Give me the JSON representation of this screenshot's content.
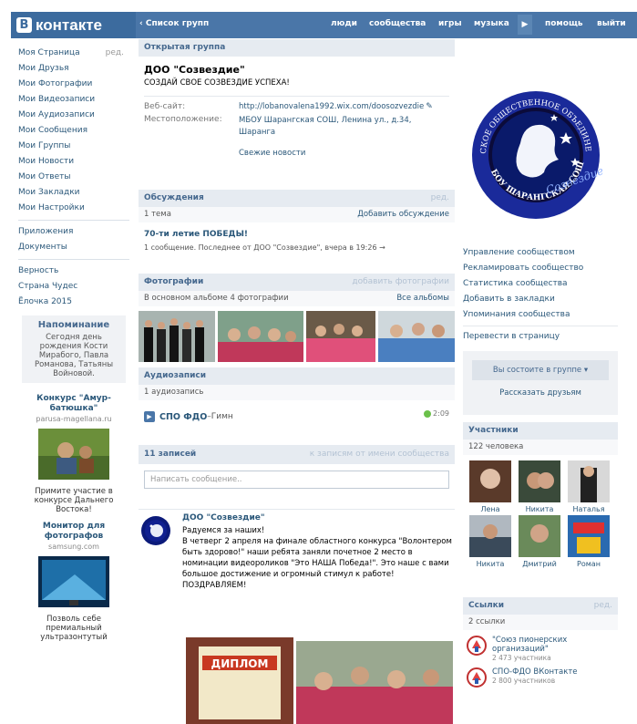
{
  "header": {
    "logo": "контакте",
    "logo_letter": "В",
    "back": "‹ Список групп",
    "nav": [
      "люди",
      "сообщества",
      "игры",
      "музыка",
      "▶",
      "помощь",
      "выйти"
    ]
  },
  "left_menu": {
    "items": [
      "Моя Страница",
      "Мои Друзья",
      "Мои Фотографии",
      "Мои Видеозаписи",
      "Мои Аудиозаписи",
      "Мои Сообщения",
      "Мои Группы",
      "Мои Новости",
      "Мои Ответы",
      "Мои Закладки",
      "Мои Настройки"
    ],
    "edit": "ред.",
    "extra": [
      "Приложения",
      "Документы"
    ],
    "apps": [
      "Верность",
      "Страна Чудес",
      "Ёлочка 2015"
    ]
  },
  "reminder": {
    "title": "Напоминание",
    "text": "Сегодня день рождения Кости Мирабого, Павла Романова, Татьяны Войновой."
  },
  "ads": [
    {
      "title": "Конкурс \"Амур-батюшка\"",
      "site": "parusa-magellana.ru",
      "desc": "Примите участие в конкурсе Дальнего Востока!"
    },
    {
      "title": "Монитор для фотографов",
      "site": "samsung.com",
      "desc": "Позволь себе премиальный ультразонтутый"
    }
  ],
  "group": {
    "type": "Открытая группа",
    "name": "ДОО \"Созвездие\"",
    "status": "СОЗДАЙ СВОЕ СОЗВЕЗДИЕ УСПЕХА!",
    "website_label": "Веб-сайт:",
    "website": "http://lobanovalena1992.wix.com/doosozvezdie",
    "location_label": "Местоположение:",
    "location": "МБОУ Шарангская СОШ, Ленина ул., д.34, Шаранга",
    "news": "Свежие новости"
  },
  "discussions": {
    "title": "Обсуждения",
    "edit": "ред.",
    "count": "1 тема",
    "add": "Добавить обсуждение",
    "topic": "70-ти летие ПОБЕДЫ!",
    "meta": "1 сообщение. Последнее от ДОО \"Созвездие\", вчера в 19:26 →"
  },
  "photos": {
    "title": "Фотографии",
    "add": "добавить фотографии",
    "count": "В основном альбоме 4 фотографии",
    "all": "Все альбомы"
  },
  "audio": {
    "title": "Аудиозаписи",
    "count": "1 аудиозапись",
    "track": "СПО ФДО",
    "dash": " – ",
    "song": "Гимн",
    "duration": "2:09"
  },
  "wall": {
    "title": "11 записей",
    "filter": "к записям от имени сообщества",
    "placeholder": "Написать сообщение..",
    "author": "ДОО \"Созвездие\"",
    "text1": "Радуемся за наших!",
    "text2": "В четверг 2 апреля на финале областного конкурса \"Волонтером быть здорово!\" наши ребята заняли почетное 2 место в номинации видеороликов \"Это НАША Победа!\". Это наше с вами большое достижение и огромный стимул к работе! ПОЗДРАВЛЯЕМ!",
    "diploma": "ДИПЛОМ"
  },
  "right": {
    "links": [
      "Управление сообществом",
      "Рекламировать сообщество",
      "Статистика сообщества",
      "Добавить в закладки",
      "Упоминания сообщества"
    ],
    "transfer": "Перевести в страницу",
    "member_btn": "Вы состоите в группе ▾",
    "tell": "Рассказать друзьям",
    "members_title": "Участники",
    "members_count": "122 человека",
    "members": [
      "Лена",
      "Никита",
      "Наталья",
      "Никита",
      "Дмитрий",
      "Роман"
    ],
    "links_title": "Ссылки",
    "links_edit": "ред.",
    "links_count": "2 ссылки",
    "ext": [
      {
        "name": "\"Союз пионерских организаций\"",
        "sub": "2 473 участника"
      },
      {
        "name": "СПО-ФДО ВКонтакте",
        "sub": "2 800 участников"
      }
    ]
  },
  "emblem": {
    "top": "ДЕТСКОЕ ОБЩЕСТВЕННОЕ ОБЪЕДИНЕНИЕ",
    "bottom": "МБОУ ШАРАНГСКАЯ СОШ",
    "center": "Созвездие"
  }
}
